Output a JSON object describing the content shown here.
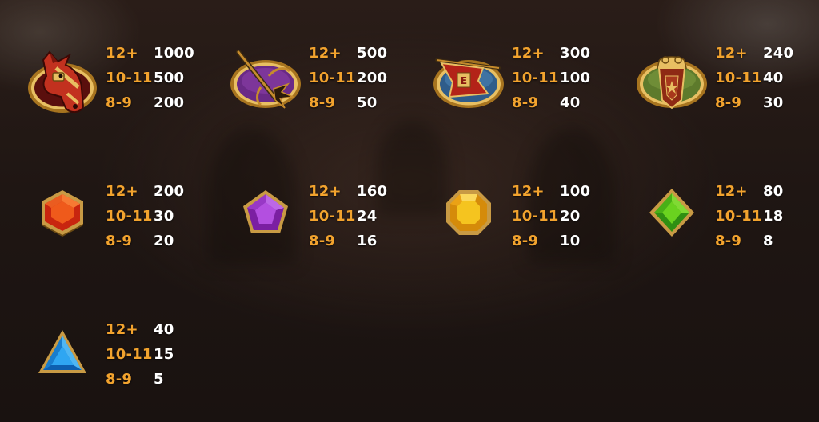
{
  "colors": {
    "count_text": "#f2a32e",
    "payout_text": "#ffffff",
    "medallion_gold": "#d9a84a"
  },
  "symbols": [
    {
      "icon": "horse-medallion-icon",
      "pays": [
        {
          "count": "12+",
          "payout": "1000"
        },
        {
          "count": "10-11",
          "payout": "500"
        },
        {
          "count": "8-9",
          "payout": "200"
        }
      ]
    },
    {
      "icon": "trident-medallion-icon",
      "pays": [
        {
          "count": "12+",
          "payout": "500"
        },
        {
          "count": "10-11",
          "payout": "200"
        },
        {
          "count": "8-9",
          "payout": "50"
        }
      ]
    },
    {
      "icon": "war-banner-medallion-icon",
      "pays": [
        {
          "count": "12+",
          "payout": "300"
        },
        {
          "count": "10-11",
          "payout": "100"
        },
        {
          "count": "8-9",
          "payout": "40"
        }
      ]
    },
    {
      "icon": "seal-medallion-icon",
      "pays": [
        {
          "count": "12+",
          "payout": "240"
        },
        {
          "count": "10-11",
          "payout": "40"
        },
        {
          "count": "8-9",
          "payout": "30"
        }
      ]
    },
    {
      "icon": "red-hexagon-gem-icon",
      "pays": [
        {
          "count": "12+",
          "payout": "200"
        },
        {
          "count": "10-11",
          "payout": "30"
        },
        {
          "count": "8-9",
          "payout": "20"
        }
      ]
    },
    {
      "icon": "purple-pentagon-gem-icon",
      "pays": [
        {
          "count": "12+",
          "payout": "160"
        },
        {
          "count": "10-11",
          "payout": "24"
        },
        {
          "count": "8-9",
          "payout": "16"
        }
      ]
    },
    {
      "icon": "yellow-octagon-gem-icon",
      "pays": [
        {
          "count": "12+",
          "payout": "100"
        },
        {
          "count": "10-11",
          "payout": "20"
        },
        {
          "count": "8-9",
          "payout": "10"
        }
      ]
    },
    {
      "icon": "green-diamond-gem-icon",
      "pays": [
        {
          "count": "12+",
          "payout": "80"
        },
        {
          "count": "10-11",
          "payout": "18"
        },
        {
          "count": "8-9",
          "payout": "8"
        }
      ]
    },
    {
      "icon": "blue-triangle-gem-icon",
      "pays": [
        {
          "count": "12+",
          "payout": "40"
        },
        {
          "count": "10-11",
          "payout": "15"
        },
        {
          "count": "8-9",
          "payout": "5"
        }
      ]
    }
  ]
}
